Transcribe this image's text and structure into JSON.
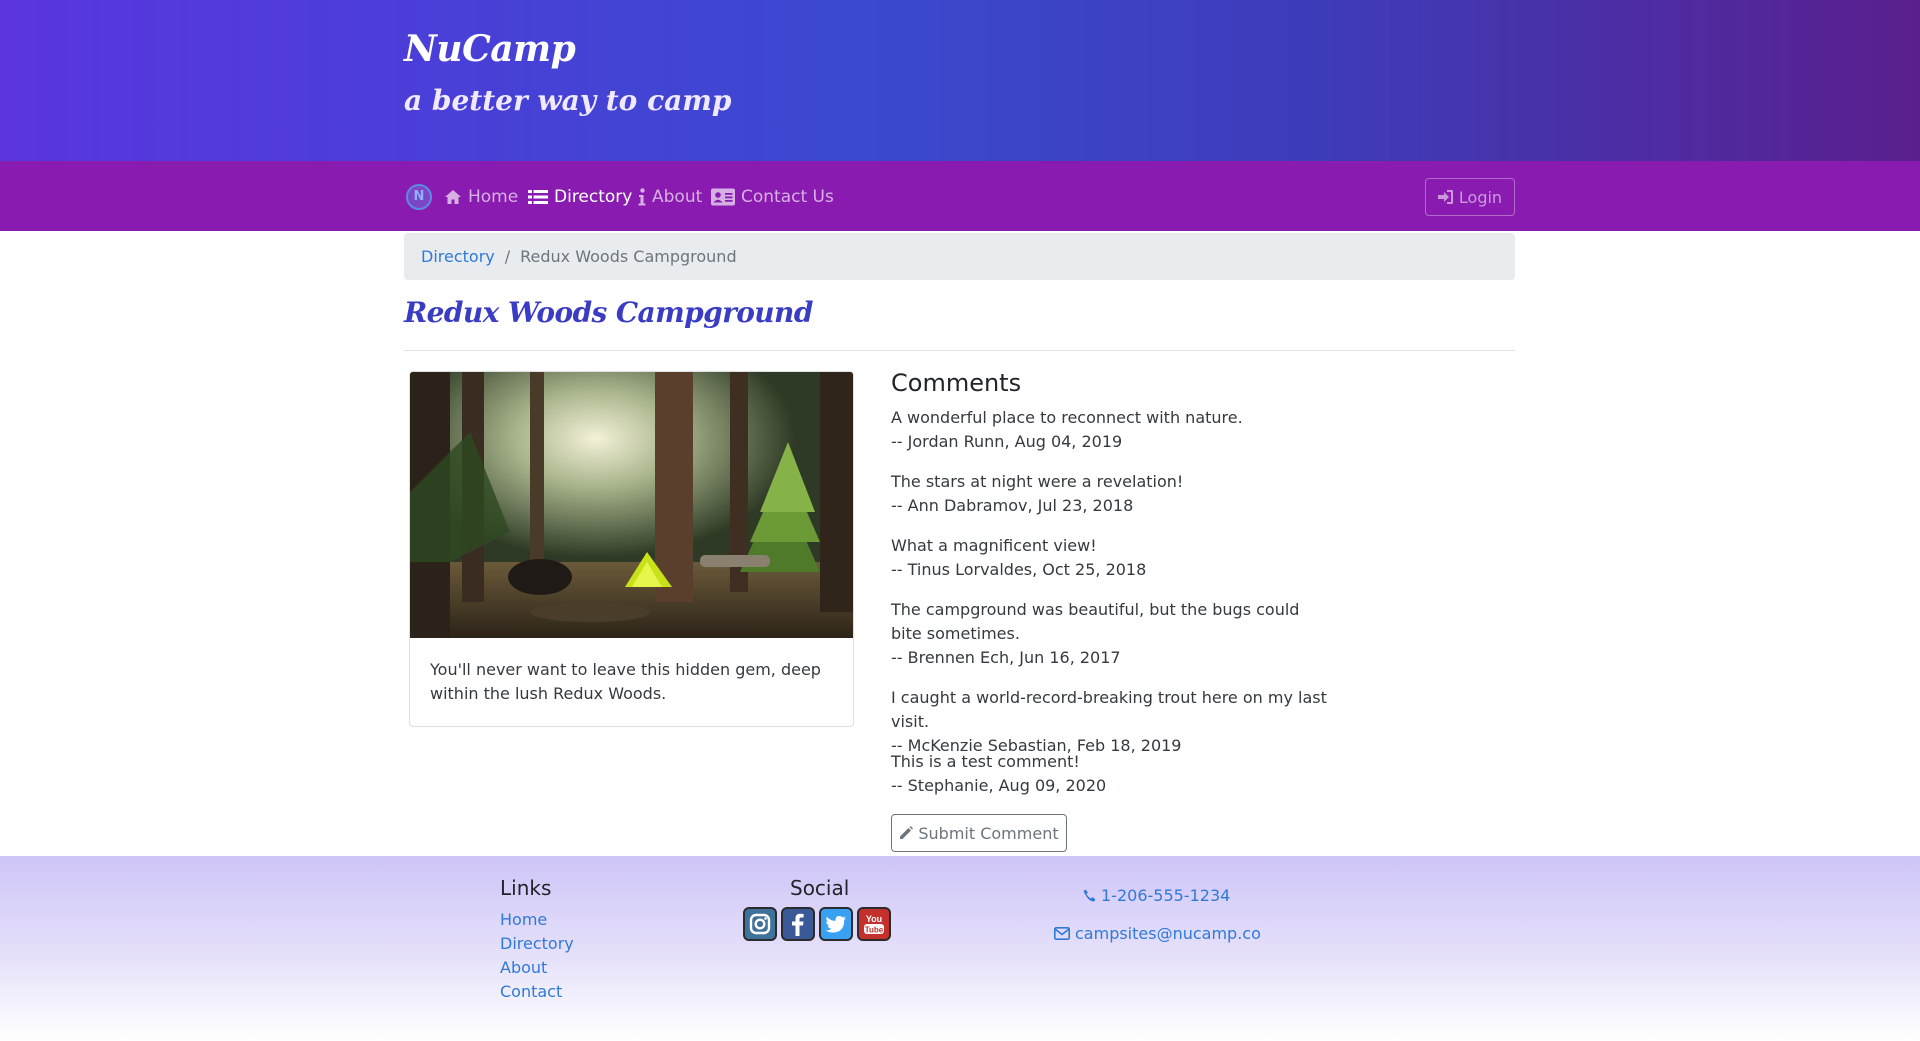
{
  "header": {
    "brand": "NuCamp",
    "tagline": "a better way to camp"
  },
  "nav": {
    "logo_icon": "nucamp-logo-icon",
    "items": [
      {
        "label": "Home",
        "icon": "home-icon",
        "active": false
      },
      {
        "label": "Directory",
        "icon": "list-icon",
        "active": true
      },
      {
        "label": "About",
        "icon": "info-icon",
        "active": false
      },
      {
        "label": "Contact Us",
        "icon": "address-card-icon",
        "active": false
      }
    ],
    "login_label": "Login"
  },
  "breadcrumb": {
    "link": "Directory",
    "separator": "/",
    "current": "Redux Woods Campground"
  },
  "page": {
    "heading": "Redux Woods Campground"
  },
  "campsite": {
    "description": "You'll never want to leave this hidden gem, deep within the lush Redux Woods."
  },
  "comments": {
    "title": "Comments",
    "items": [
      {
        "text": "A wonderful place to reconnect with nature.",
        "byline": "-- Jordan Runn, Aug 04, 2019"
      },
      {
        "text": "The stars at night were a revelation!",
        "byline": "-- Ann Dabramov, Jul 23, 2018"
      },
      {
        "text": "What a magnificent view!",
        "byline": "-- Tinus Lorvaldes, Oct 25, 2018"
      },
      {
        "text": "The campground was beautiful, but the bugs could bite sometimes.",
        "byline": "-- Brennen Ech, Jun 16, 2017"
      },
      {
        "text": "I caught a world-record-breaking trout here on my last visit.",
        "byline": "-- McKenzie Sebastian, Feb 18, 2019"
      },
      {
        "text": "This is a test comment!",
        "byline": "-- Stephanie, Aug 09, 2020"
      }
    ],
    "submit_label": "Submit Comment"
  },
  "footer": {
    "links_heading": "Links",
    "links": [
      "Home",
      "Directory",
      "About",
      "Contact"
    ],
    "social_heading": "Social",
    "social_icons": [
      "instagram-icon",
      "facebook-icon",
      "twitter-icon",
      "youtube-icon"
    ],
    "phone": "1-206-555-1234",
    "email": "campsites@nucamp.co"
  },
  "colors": {
    "navbar": "#8a1bb0",
    "link": "#2f7ad8",
    "heading": "#3a3cc4"
  }
}
